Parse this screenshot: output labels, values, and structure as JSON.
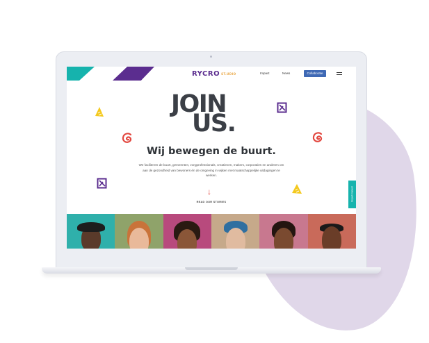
{
  "site": {
    "logo_main": "RYCRO",
    "logo_sub": "ST.UDIO"
  },
  "nav": {
    "impact_label": "Impact",
    "news_label": "News",
    "collaborate_label": "Collaborate"
  },
  "hero": {
    "join_line1": "JOIN",
    "join_line2": "US.",
    "headline": "Wij bewegen de buurt.",
    "paragraph": "We faciliteren de buurt, gemeenten, zorgprofessionals, creatieven, makers, corporaties en anderen om aan de gezondheid van bewoners én de omgeving in wijken met maatschappelijke uitdagingen te werken.",
    "arrow": "↓",
    "cta_label": "READ OUR STORIES"
  },
  "side_tab": {
    "label": "Impact maken!"
  },
  "colors": {
    "teal": "#16b3ad",
    "purple": "#5b2d8f",
    "red": "#e2463e",
    "yellow": "#f4c91d",
    "button_blue": "#3f69b5",
    "blob": "#e0d7e9"
  },
  "icons": [
    "triangle-yellow-icon",
    "spiral-red-icon",
    "square-purple-icon",
    "hamburger-menu-icon",
    "down-arrow-icon"
  ]
}
